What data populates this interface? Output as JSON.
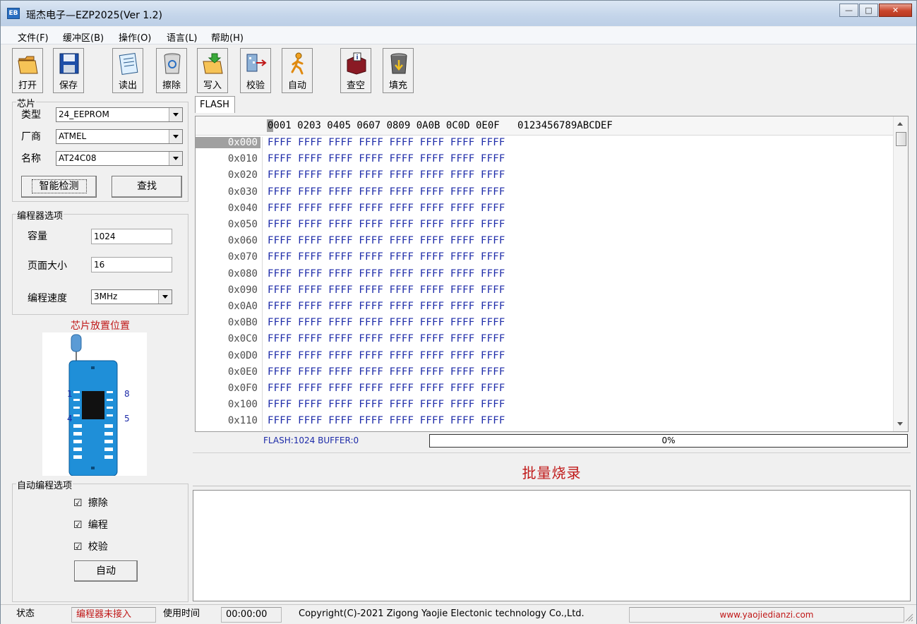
{
  "window": {
    "title": "瑶杰电子—EZP2025(Ver 1.2)",
    "icon_text": "EB"
  },
  "menu": [
    "文件(F)",
    "缓冲区(B)",
    "操作(O)",
    "语言(L)",
    "帮助(H)"
  ],
  "toolbar": {
    "open": "打开",
    "save": "保存",
    "read": "读出",
    "erase": "擦除",
    "write": "写入",
    "verify": "校验",
    "auto": "自动",
    "blank": "查空",
    "fill": "填充"
  },
  "chip": {
    "group_title": "芯片",
    "type_label": "类型",
    "type_value": "24_EEPROM",
    "vendor_label": "厂商",
    "vendor_value": "ATMEL",
    "name_label": "名称",
    "name_value": "AT24C08",
    "detect_button": "智能检测",
    "find_button": "查找"
  },
  "programmer": {
    "group_title": "编程器选项",
    "capacity_label": "容量",
    "capacity_value": "1024",
    "page_label": "页面大小",
    "page_value": "16",
    "speed_label": "编程速度",
    "speed_value": "3MHz"
  },
  "placement": {
    "title": "芯片放置位置",
    "pin1": "1",
    "pin4": "4",
    "pin5": "5",
    "pin8": "8"
  },
  "auto_options": {
    "group_title": "自动编程选项",
    "erase": "擦除",
    "program": "编程",
    "verify": "校验",
    "check_mark": "☑",
    "auto_button": "自动"
  },
  "hex": {
    "tab": "FLASH",
    "header": "0001 0203 0405 0607 0809 0A0B 0C0D 0E0F   0123456789ABCDEF",
    "rows": [
      {
        "addr": "0x000",
        "data": "FFFF FFFF FFFF FFFF FFFF FFFF FFFF FFFF"
      },
      {
        "addr": "0x010",
        "data": "FFFF FFFF FFFF FFFF FFFF FFFF FFFF FFFF"
      },
      {
        "addr": "0x020",
        "data": "FFFF FFFF FFFF FFFF FFFF FFFF FFFF FFFF"
      },
      {
        "addr": "0x030",
        "data": "FFFF FFFF FFFF FFFF FFFF FFFF FFFF FFFF"
      },
      {
        "addr": "0x040",
        "data": "FFFF FFFF FFFF FFFF FFFF FFFF FFFF FFFF"
      },
      {
        "addr": "0x050",
        "data": "FFFF FFFF FFFF FFFF FFFF FFFF FFFF FFFF"
      },
      {
        "addr": "0x060",
        "data": "FFFF FFFF FFFF FFFF FFFF FFFF FFFF FFFF"
      },
      {
        "addr": "0x070",
        "data": "FFFF FFFF FFFF FFFF FFFF FFFF FFFF FFFF"
      },
      {
        "addr": "0x080",
        "data": "FFFF FFFF FFFF FFFF FFFF FFFF FFFF FFFF"
      },
      {
        "addr": "0x090",
        "data": "FFFF FFFF FFFF FFFF FFFF FFFF FFFF FFFF"
      },
      {
        "addr": "0x0A0",
        "data": "FFFF FFFF FFFF FFFF FFFF FFFF FFFF FFFF"
      },
      {
        "addr": "0x0B0",
        "data": "FFFF FFFF FFFF FFFF FFFF FFFF FFFF FFFF"
      },
      {
        "addr": "0x0C0",
        "data": "FFFF FFFF FFFF FFFF FFFF FFFF FFFF FFFF"
      },
      {
        "addr": "0x0D0",
        "data": "FFFF FFFF FFFF FFFF FFFF FFFF FFFF FFFF"
      },
      {
        "addr": "0x0E0",
        "data": "FFFF FFFF FFFF FFFF FFFF FFFF FFFF FFFF"
      },
      {
        "addr": "0x0F0",
        "data": "FFFF FFFF FFFF FFFF FFFF FFFF FFFF FFFF"
      },
      {
        "addr": "0x100",
        "data": "FFFF FFFF FFFF FFFF FFFF FFFF FFFF FFFF"
      },
      {
        "addr": "0x110",
        "data": "FFFF FFFF FFFF FFFF FFFF FFFF FFFF FFFF"
      }
    ],
    "buffer_info": "FLASH:1024 BUFFER:0",
    "progress_text": "0%",
    "progress_value": 0
  },
  "batch": {
    "label": "批量烧录"
  },
  "status": {
    "state_label": "状态",
    "state_value": "编程器未接入",
    "time_label": "使用时间",
    "time_value": "00:00:00",
    "copyright": "Copyright(C)-2021 Zigong Yaojie Electonic technology Co.,Ltd.",
    "website": "www.yaojiedianzi.com"
  },
  "colors": {
    "hex_text": "#1c2aa8",
    "alert_red": "#c01818",
    "selected_row": "#a0a0a0"
  }
}
